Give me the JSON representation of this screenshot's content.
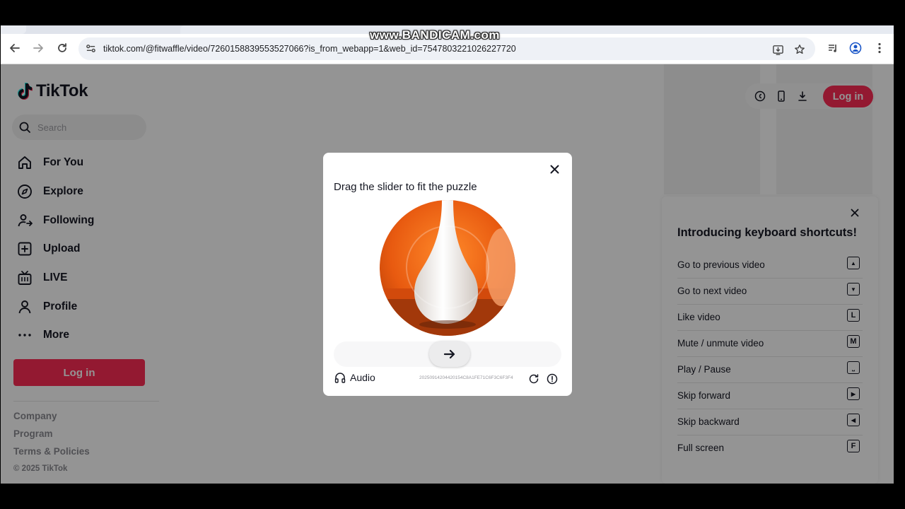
{
  "watermark": "www.BANDICAM.com",
  "browser": {
    "url": "tiktok.com/@fitwaffle/video/7260158839553527066?is_from_webapp=1&web_id=7547803221026227720"
  },
  "sidebar": {
    "logo": "TikTok",
    "search_placeholder": "Search",
    "items": [
      {
        "label": "For You",
        "icon": "home-icon"
      },
      {
        "label": "Explore",
        "icon": "compass-icon"
      },
      {
        "label": "Following",
        "icon": "following-icon"
      },
      {
        "label": "Upload",
        "icon": "upload-icon"
      },
      {
        "label": "LIVE",
        "icon": "live-icon"
      },
      {
        "label": "Profile",
        "icon": "profile-icon"
      },
      {
        "label": "More",
        "icon": "more-icon"
      }
    ],
    "login_label": "Log in",
    "footer": {
      "company": "Company",
      "program": "Program",
      "terms": "Terms & Policies",
      "copyright": "© 2025 TikTok"
    }
  },
  "header": {
    "login_label": "Log in"
  },
  "shortcuts": {
    "title": "Introducing keyboard shortcuts!",
    "rows": [
      {
        "label": "Go to previous video",
        "key": "▲"
      },
      {
        "label": "Go to next video",
        "key": "▼"
      },
      {
        "label": "Like video",
        "key": "L"
      },
      {
        "label": "Mute / unmute video",
        "key": "M"
      },
      {
        "label": "Play / Pause",
        "key": "⎵"
      },
      {
        "label": "Skip forward",
        "key": "▶"
      },
      {
        "label": "Skip backward",
        "key": "◀"
      },
      {
        "label": "Full screen",
        "key": "F"
      }
    ]
  },
  "captcha": {
    "title": "Drag the slider to fit the puzzle",
    "audio_label": "Audio",
    "code": "20250914204420154C8A1FE71C6F3C6F3F4",
    "slider_position": 0
  },
  "colors": {
    "brand": "#fe2c55",
    "puzzle_orange": "#e85a10"
  }
}
